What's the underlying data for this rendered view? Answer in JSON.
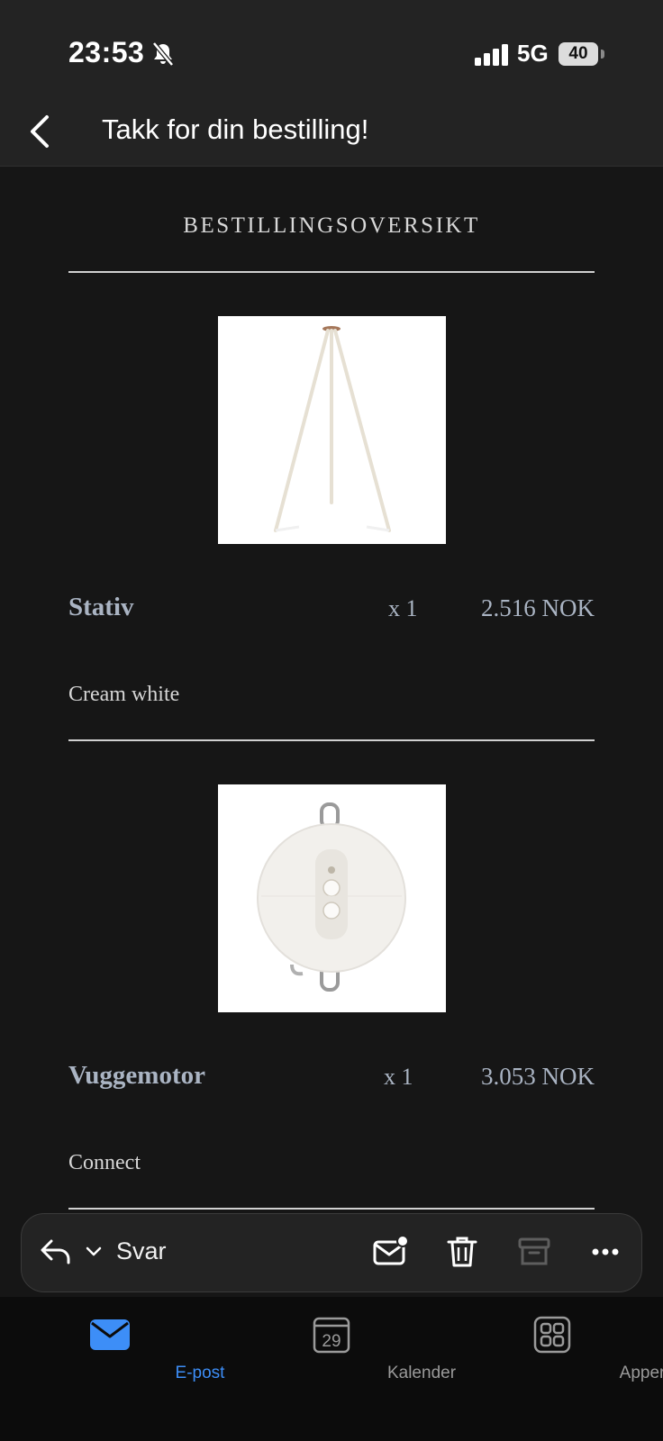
{
  "status_bar": {
    "time": "23:53",
    "network": "5G",
    "battery": "40",
    "icons": [
      "silent-bell-icon",
      "signal-icon"
    ]
  },
  "nav": {
    "title": "Takk for din bestilling!",
    "back_icon": "chevron-left-icon"
  },
  "email": {
    "section_title": "BESTILLINGSOVERSIKT",
    "items": [
      {
        "name": "Stativ",
        "qty": "x 1",
        "price": "2.516 NOK",
        "variant": "Cream white",
        "image": "tripod-stand"
      },
      {
        "name": "Vuggemotor",
        "qty": "x 1",
        "price": "3.053 NOK",
        "variant": "Connect",
        "image": "cradle-motor"
      }
    ]
  },
  "action_bar": {
    "reply_label": "Svar",
    "icons": [
      "reply-icon",
      "chevron-down-icon",
      "mark-unread-icon",
      "trash-icon",
      "archive-icon",
      "more-icon"
    ]
  },
  "tab_bar": {
    "tabs": [
      {
        "label": "E-post",
        "icon": "mail-icon",
        "active": true
      },
      {
        "label": "Kalender",
        "icon": "calendar-icon",
        "badge": "29"
      },
      {
        "label": "Apper",
        "icon": "apps-grid-icon"
      }
    ],
    "accent": "#3d8ef7"
  }
}
